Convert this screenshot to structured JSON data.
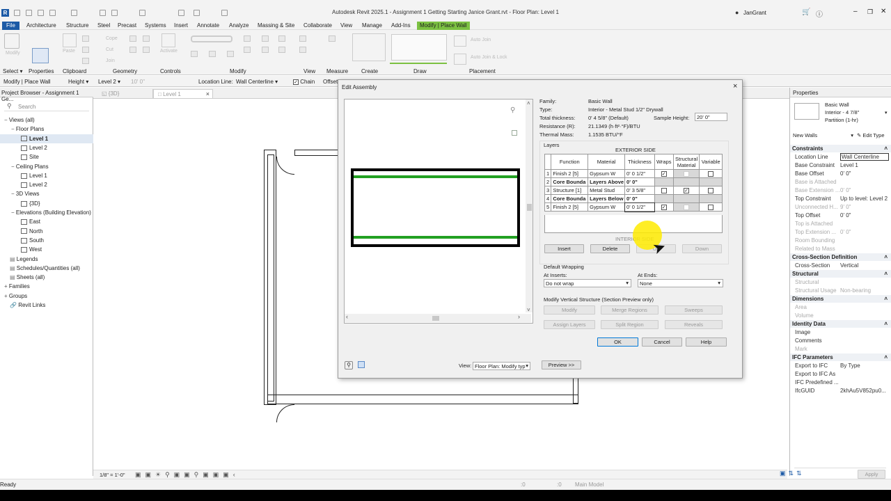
{
  "app": {
    "title": "Autodesk Revit 2025.1 - Assignment 1 Getting Starting Janice Grant.rvt - Floor Plan: Level 1",
    "user": "JanGrant",
    "logo": "R"
  },
  "menu": [
    "File",
    "Architecture",
    "Structure",
    "Steel",
    "Precast",
    "Systems",
    "Insert",
    "Annotate",
    "Analyze",
    "Massing & Site",
    "Collaborate",
    "View",
    "Manage",
    "Add-Ins",
    "Modify | Place Wall"
  ],
  "ribbon": {
    "panels": [
      "Select",
      "Properties",
      "Clipboard",
      "Geometry",
      "Controls",
      "Modify",
      "View",
      "Measure",
      "Create",
      "Draw",
      "Placement"
    ],
    "ghost": {
      "modify": "Modify",
      "paste": "Paste",
      "activate": "Activate",
      "cope": "Cope",
      "cut": "Cut",
      "join": "Join",
      "auto_join": "Auto Join",
      "auto_join_lock": "Auto Join & Lock"
    }
  },
  "options": {
    "context": "Modify | Place Wall",
    "height_label": "Height",
    "level": "Level 2",
    "height_value": "10'  0\"",
    "location_line_label": "Location Line:",
    "location_line": "Wall Centerline",
    "chain": "Chain",
    "offset": "Offset"
  },
  "browser": {
    "title": "Project Browser - Assignment 1 Ge...",
    "search": "Search",
    "items": [
      {
        "label": "Views (all)",
        "indent": 0,
        "icon": "minus"
      },
      {
        "label": "Floor Plans",
        "indent": 1,
        "icon": "minus"
      },
      {
        "label": "Level 1",
        "indent": 2,
        "icon": "view",
        "selected": true
      },
      {
        "label": "Level 2",
        "indent": 2,
        "icon": "view"
      },
      {
        "label": "Site",
        "indent": 2,
        "icon": "view"
      },
      {
        "label": "Ceiling Plans",
        "indent": 1,
        "icon": "minus"
      },
      {
        "label": "Level 1",
        "indent": 2,
        "icon": "view"
      },
      {
        "label": "Level 2",
        "indent": 2,
        "icon": "view"
      },
      {
        "label": "3D Views",
        "indent": 1,
        "icon": "minus"
      },
      {
        "label": "{3D}",
        "indent": 2,
        "icon": "view"
      },
      {
        "label": "Elevations (Building Elevation)",
        "indent": 1,
        "icon": "minus"
      },
      {
        "label": "East",
        "indent": 2,
        "icon": "view"
      },
      {
        "label": "North",
        "indent": 2,
        "icon": "view"
      },
      {
        "label": "South",
        "indent": 2,
        "icon": "view"
      },
      {
        "label": "West",
        "indent": 2,
        "icon": "view"
      },
      {
        "label": "Legends",
        "indent": 0,
        "icon": "legend"
      },
      {
        "label": "Schedules/Quantities (all)",
        "indent": 0,
        "icon": "legend"
      },
      {
        "label": "Sheets (all)",
        "indent": 0,
        "icon": "legend"
      },
      {
        "label": "Families",
        "indent": 0,
        "icon": "plus"
      },
      {
        "label": "Groups",
        "indent": 0,
        "icon": "plus"
      },
      {
        "label": "Revit Links",
        "indent": 0,
        "icon": "link"
      }
    ]
  },
  "tabs": [
    {
      "label": "{3D}"
    },
    {
      "label": "Level 1"
    }
  ],
  "viewctl": {
    "scale": "1/8\" = 1'-0\""
  },
  "status": {
    "left": "Ready",
    "right_model": "Main Model",
    "zero1": ":0",
    "zero2": ":0"
  },
  "properties": {
    "title": "Properties",
    "type1": "Basic Wall",
    "type2": "Interior - 4 7/8\"",
    "type3": "Partition (1-hr)",
    "selector": "New Walls",
    "edit_type": "Edit Type",
    "apply": "Apply",
    "groups": [
      {
        "name": "Constraints",
        "rows": [
          [
            "Location Line",
            "Wall Centerline",
            false
          ],
          [
            "Base Constraint",
            "Level 1",
            false
          ],
          [
            "Base Offset",
            "0'  0\"",
            false
          ],
          [
            "Base is Attached",
            "",
            true
          ],
          [
            "Base Extension ...",
            "0'  0\"",
            true
          ],
          [
            "Top Constraint",
            "Up to level: Level 2",
            false
          ],
          [
            "Unconnected H...",
            "9'  0\"",
            true
          ],
          [
            "Top Offset",
            "0'  0\"",
            false
          ],
          [
            "Top is Attached",
            "",
            true
          ],
          [
            "Top Extension ...",
            "0'  0\"",
            true
          ],
          [
            "Room Bounding",
            "",
            true
          ],
          [
            "Related to Mass",
            "",
            true
          ]
        ]
      },
      {
        "name": "Cross-Section Definition",
        "rows": [
          [
            "Cross-Section",
            "Vertical",
            false
          ]
        ]
      },
      {
        "name": "Structural",
        "rows": [
          [
            "Structural",
            "",
            true
          ],
          [
            "Structural Usage",
            "Non-bearing",
            true
          ]
        ]
      },
      {
        "name": "Dimensions",
        "rows": [
          [
            "Area",
            "",
            true
          ],
          [
            "Volume",
            "",
            true
          ]
        ]
      },
      {
        "name": "Identity Data",
        "rows": [
          [
            "Image",
            "",
            false
          ],
          [
            "Comments",
            "",
            false
          ],
          [
            "Mark",
            "",
            true
          ]
        ]
      },
      {
        "name": "IFC Parameters",
        "rows": [
          [
            "Export to IFC",
            "By Type",
            false
          ],
          [
            "Export to IFC As",
            "",
            false
          ],
          [
            "IFC Predefined ...",
            "",
            false
          ],
          [
            "IfcGUID",
            "2khAu5V852pu0...",
            false
          ]
        ]
      }
    ]
  },
  "dialog": {
    "title": "Edit Assembly",
    "info": [
      [
        "Family:",
        "Basic Wall"
      ],
      [
        "Type:",
        "Interior - Metal Stud 1/2\" Drywall"
      ],
      [
        "Total thickness:",
        "0'  4 5/8\" (Default)"
      ],
      [
        "Resistance (R):",
        "21.1349 (h·ft²·°F)/BTU"
      ],
      [
        "Thermal Mass:",
        "1.1535 BTU/°F"
      ]
    ],
    "sample_height_label": "Sample Height:",
    "sample_height": "20'  0\"",
    "layers_label": "Layers",
    "exterior": "EXTERIOR SIDE",
    "interior": "INTERIOR SIDE",
    "columns": [
      "Function",
      "Material",
      "Thickness",
      "Wraps",
      "Structural Material",
      "Variable"
    ],
    "rows": [
      {
        "n": "1",
        "function": "Finish 2 [5]",
        "material": "Gypsum W",
        "thickness": "0'  0 1/2\"",
        "wraps": true,
        "struct": false,
        "variable": false,
        "bold": false
      },
      {
        "n": "2",
        "function": "Core Bounda",
        "material": "Layers Above",
        "thickness": "0'  0\"",
        "bold": true
      },
      {
        "n": "3",
        "function": "Structure [1]",
        "material": "Metal Stud",
        "thickness": "0'  3 5/8\"",
        "wraps": false,
        "struct": true,
        "variable": false,
        "bold": false
      },
      {
        "n": "4",
        "function": "Core Bounda",
        "material": "Layers Below",
        "thickness": "0'  0\"",
        "bold": true
      },
      {
        "n": "5",
        "function": "Finish 2 [5]",
        "material": "Gypsum W",
        "thickness": "0'  0 1/2\"",
        "wraps": true,
        "struct": false,
        "variable": false,
        "bold": false
      }
    ],
    "insert": "Insert",
    "delete": "Delete",
    "up": "Up",
    "down": "Down",
    "wrapping_label": "Default Wrapping",
    "at_inserts_label": "At Inserts:",
    "at_inserts": "Do not wrap",
    "at_ends_label": "At Ends:",
    "at_ends": "None",
    "vertical_label": "Modify Vertical Structure (Section Preview only)",
    "vbtns": [
      "Modify",
      "Merge Regions",
      "Sweeps",
      "Assign Layers",
      "Split Region",
      "Reveals"
    ],
    "ok": "OK",
    "cancel": "Cancel",
    "help": "Help",
    "view_label": "View:",
    "view": "Floor Plan: Modify typ",
    "preview": "Preview >>",
    "colors": {
      "finish": "#22a022",
      "accent": "#0078d7"
    }
  }
}
